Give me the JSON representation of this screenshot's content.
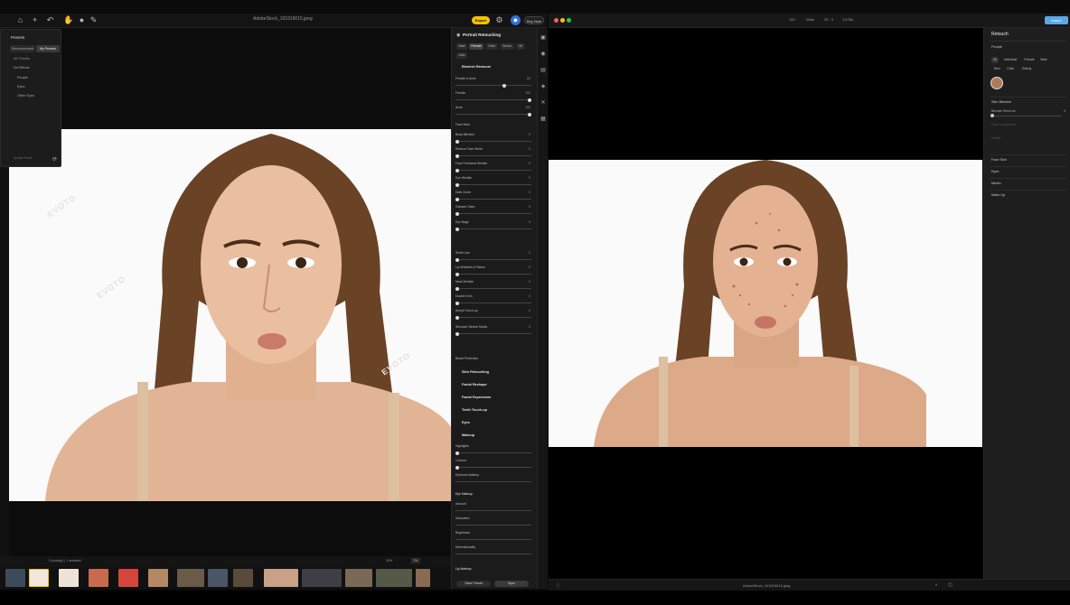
{
  "left_app": {
    "title": "AdobeStock_101819015.jpeg",
    "export_label": "Export",
    "buy_label": "Buy Now",
    "presets": {
      "header": "Presets",
      "tabs": [
        "Recommended",
        "My Presets"
      ],
      "filter": "All Presets",
      "items": [
        "No Effects",
        "People",
        "Eyes",
        "Other Eyes"
      ],
      "footer": "Update Preset"
    },
    "watermark": "EVOTO",
    "bottom": {
      "status": "0 photo(s) | 1 selected",
      "zoom": "30%",
      "fit": "Fit"
    },
    "panel": {
      "title": "Portrait Retouching",
      "chips": [
        "Male",
        "Female",
        "Child",
        "Senior",
        "All",
        "Auto"
      ],
      "section_blemish": "Blemish Removal",
      "rows": [
        {
          "label": "Freckle & Acne",
          "value": "82"
        },
        {
          "label": "Freckle",
          "value": "100"
        },
        {
          "label": "Acne",
          "value": "100"
        },
        {
          "label": "Face Mole",
          "value": ""
        },
        {
          "label": "Body Blemish",
          "value": "0"
        },
        {
          "label": "Reduce Face Shine",
          "value": "0"
        },
        {
          "label": "Face Forehead Wrinkle",
          "value": "0"
        },
        {
          "label": "Eye Wrinkle",
          "value": "0"
        },
        {
          "label": "Dark Circle",
          "value": "0"
        },
        {
          "label": "Glasses Glare",
          "value": "0"
        },
        {
          "label": "Eye Bags",
          "value": "0"
        },
        {
          "label": "Smile Line",
          "value": "0"
        },
        {
          "label": "Lip Wrinkles & Flakes",
          "value": "0"
        },
        {
          "label": "Neck Wrinkle",
          "value": "0"
        },
        {
          "label": "Double Chin",
          "value": "0"
        },
        {
          "label": "Armpit Touch-up",
          "value": "0"
        },
        {
          "label": "Stomach Stretch Marks",
          "value": "0"
        },
        {
          "label": "Beard Protection",
          "value": ""
        }
      ],
      "sections": [
        "Skin Retouching",
        "Facial Reshape",
        "Facial Expression",
        "Teeth Touch-up",
        "Eyes",
        "Makeup"
      ],
      "makeup_rows": [
        "Highlights",
        "Contour",
        "Eyebrow Makeup",
        "Eye Makeup",
        "Amount",
        "Saturation",
        "Brightness",
        "Dimensionality",
        "Lip Makeup"
      ],
      "save_preset": "Save Preset",
      "sync": "Sync"
    }
  },
  "right_app": {
    "toolbar": [
      "100",
      "Wide",
      "25 · 0",
      "1/125s"
    ],
    "import_label": "Import",
    "panel": {
      "title": "Retouch",
      "people": "People",
      "chips": [
        "All",
        "Individual",
        "Female",
        "Male",
        "Teen",
        "Child",
        "Elderly"
      ],
      "skin_blemish": "Skin Blemish",
      "blemish_removal": "Blemish Removal",
      "blemish_value": "0",
      "face_smoothness": "Face Smoothness",
      "details": "Details",
      "sections": [
        "Face Skin",
        "Eyes",
        "Mouth",
        "Make Up"
      ]
    },
    "filename": "AdobeStock_101819015.jpeg"
  },
  "colors": {
    "accent_yellow": "#f5c400",
    "accent_blue": "#5aa9e6",
    "panel": "#1b1b1b"
  }
}
